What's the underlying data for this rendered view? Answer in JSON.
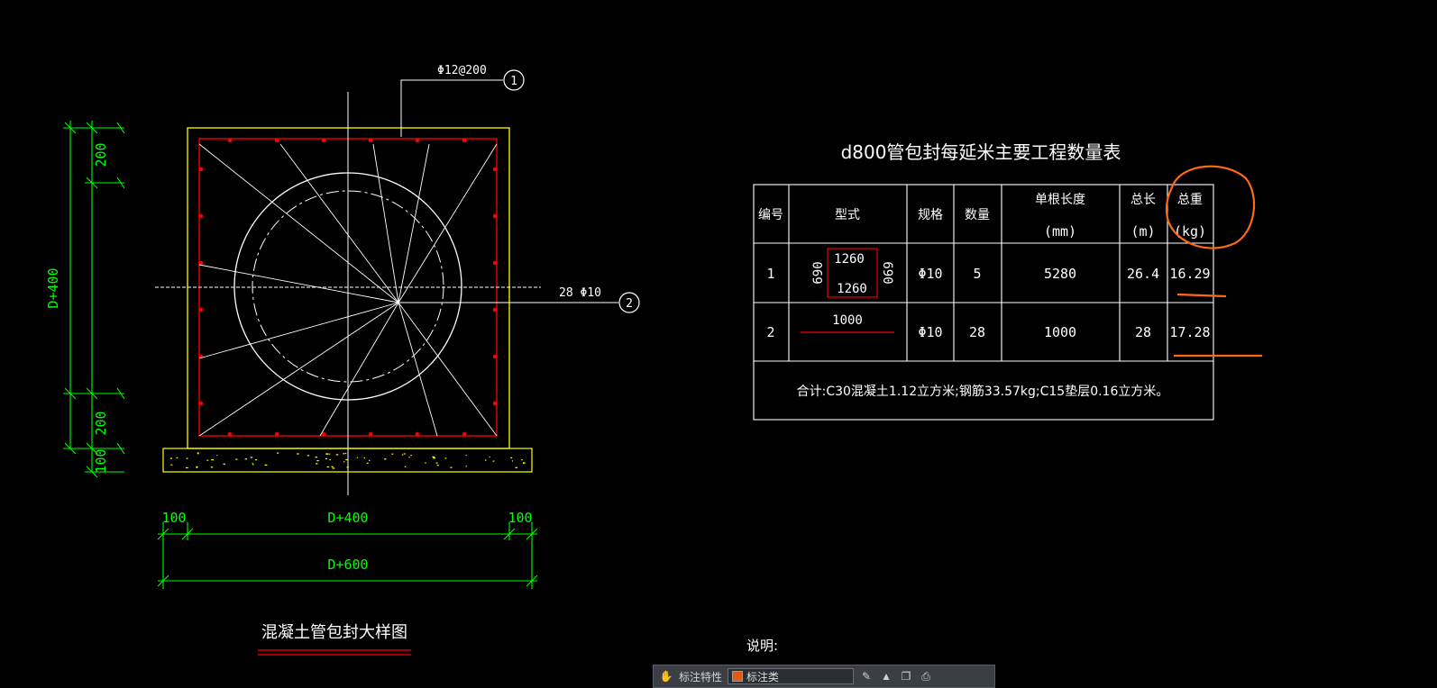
{
  "drawing": {
    "left_title": "混凝土管包封大样图",
    "table_title": "d800管包封每延米主要工程数量表",
    "note_label": "说明:",
    "labels": {
      "top_rebar": "Φ12@200",
      "callout_1": "1",
      "side_rebar": "28 Φ10",
      "callout_2": "2"
    },
    "dims": {
      "left_top": "200",
      "left_mid": "D+400",
      "left_bottom": "200",
      "left_base": "100",
      "bottom_left": "100",
      "bottom_mid": "D+400",
      "bottom_right": "100",
      "bottom_total": "D+600"
    }
  },
  "table": {
    "headers": [
      "编号",
      "型式",
      "规格",
      "数量",
      "单根长度",
      "总长",
      "总重"
    ],
    "header_units": [
      "",
      "",
      "",
      "",
      "(mm)",
      "(m)",
      "(kg)"
    ],
    "rows": [
      {
        "no": "1",
        "shape_top": "1260",
        "shape_bottom": "1260",
        "shape_left": "690",
        "shape_right": "690",
        "spec": "Φ10",
        "qty": "5",
        "length": "5280",
        "total_len": "26.4",
        "weight": "16.29"
      },
      {
        "no": "2",
        "shape_top": "1000",
        "spec": "Φ10",
        "qty": "28",
        "length": "1000",
        "total_len": "28",
        "weight": "17.28"
      }
    ],
    "summary": "合计:C30混凝土1.12立方米;钢筋33.57kg;C15垫层0.16立方米。"
  },
  "toolbar": {
    "icon_left": "hand-icon",
    "label": "标注特性",
    "combo_value": "标注类",
    "icons": [
      "edit-icon",
      "triangle-icon",
      "copy-icon",
      "print-icon"
    ]
  },
  "colors": {
    "green": "#00ff00",
    "yellow": "#ffff00",
    "red": "#ff0000",
    "white": "#ffffff",
    "orange": "#ff6a13"
  }
}
